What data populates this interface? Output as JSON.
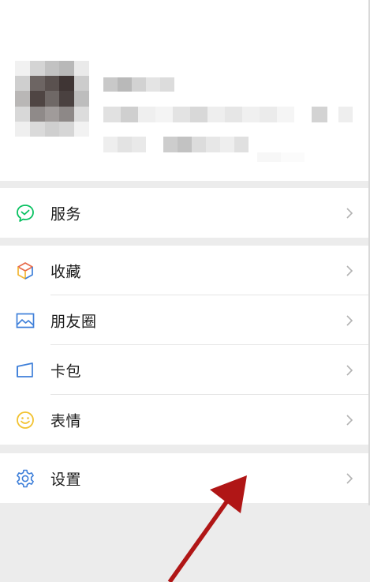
{
  "menu": {
    "services": {
      "label": "服务",
      "icon": "wechat-pay-icon"
    },
    "favorites": {
      "label": "收藏",
      "icon": "cube-icon"
    },
    "moments": {
      "label": "朋友圈",
      "icon": "image-icon"
    },
    "card_wallet": {
      "label": "卡包",
      "icon": "card-icon"
    },
    "stickers": {
      "label": "表情",
      "icon": "smiley-icon"
    },
    "settings": {
      "label": "设置",
      "icon": "gear-icon"
    }
  },
  "colors": {
    "background": "#ececec",
    "surface": "#ffffff",
    "green": "#07c160",
    "blue": "#3e7fd9",
    "yellow": "#f2c230",
    "annotation_arrow": "#b01616"
  }
}
